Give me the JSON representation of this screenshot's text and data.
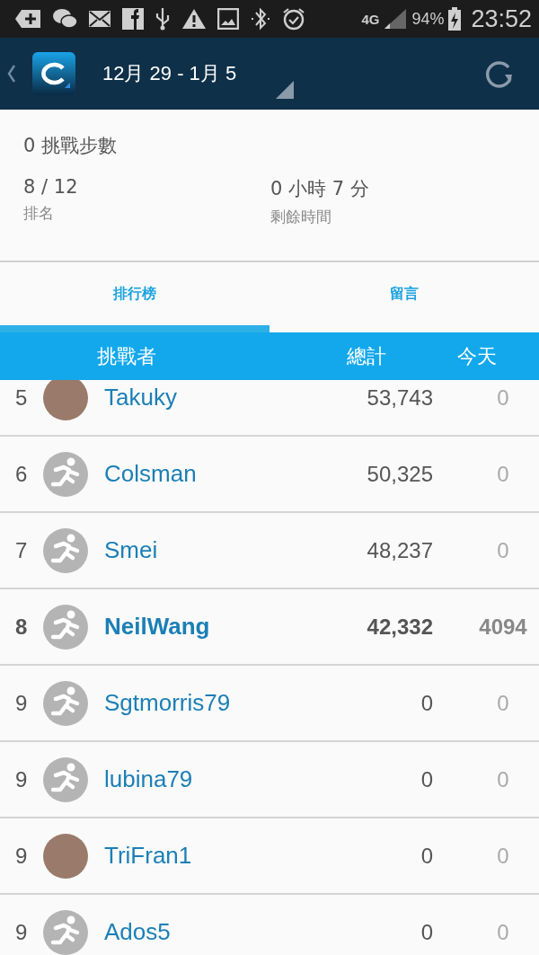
{
  "status_bar": {
    "network": "4G",
    "battery": "94%",
    "time": "23:52"
  },
  "app_bar": {
    "title": "12月 29 - 1月 5"
  },
  "summary": {
    "steps": "0 挑戰步數",
    "stats": [
      {
        "value": "8 / 12",
        "label": "排名"
      },
      {
        "value": "0 小時 7 分",
        "label": "剩餘時間"
      }
    ]
  },
  "tabs": [
    {
      "label": "排行榜",
      "selected": true
    },
    {
      "label": "留言",
      "selected": false
    }
  ],
  "table": {
    "columns": [
      "挑戰者",
      "總計",
      "今天"
    ],
    "rows": [
      {
        "rank": "5",
        "name": "Takuky",
        "total": "53,743",
        "today": "0",
        "kind": "photo",
        "highlighted": false
      },
      {
        "rank": "6",
        "name": "Colsman",
        "total": "50,325",
        "today": "0",
        "kind": "default",
        "highlighted": false
      },
      {
        "rank": "7",
        "name": "Smei",
        "total": "48,237",
        "today": "0",
        "kind": "default",
        "highlighted": false
      },
      {
        "rank": "8",
        "name": "NeilWang",
        "total": "42,332",
        "today": "4094",
        "kind": "default",
        "highlighted": true
      },
      {
        "rank": "9",
        "name": "Sgtmorris79",
        "total": "0",
        "today": "0",
        "kind": "default",
        "highlighted": false
      },
      {
        "rank": "9",
        "name": "lubina79",
        "total": "0",
        "today": "0",
        "kind": "default",
        "highlighted": false
      },
      {
        "rank": "9",
        "name": "TriFran1",
        "total": "0",
        "today": "0",
        "kind": "photo",
        "highlighted": false
      },
      {
        "rank": "9",
        "name": "Ados5",
        "total": "0",
        "today": "0",
        "kind": "default",
        "highlighted": false
      }
    ]
  }
}
